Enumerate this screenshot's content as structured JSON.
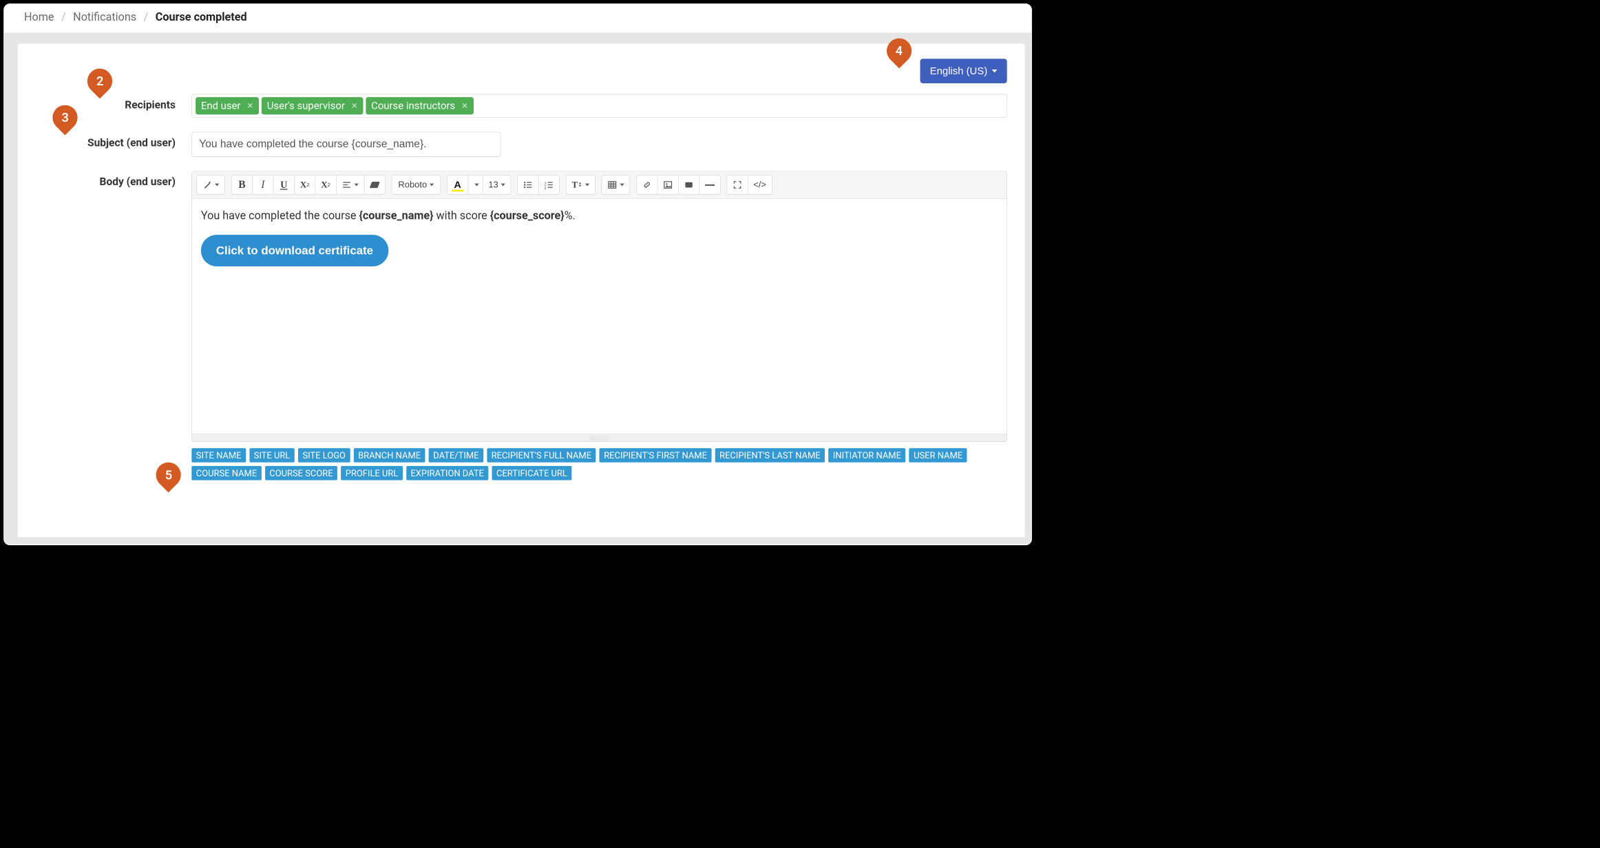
{
  "breadcrumb": {
    "home": "Home",
    "notifications": "Notifications",
    "current": "Course completed"
  },
  "language": {
    "label": "English (US)"
  },
  "form": {
    "recipients_label": "Recipients",
    "subject_label": "Subject (end user)",
    "body_label": "Body (end user)",
    "recipients": [
      {
        "label": "End user"
      },
      {
        "label": "User's supervisor"
      },
      {
        "label": "Course instructors"
      }
    ],
    "subject_value": "You have completed the course {course_name}."
  },
  "toolbar": {
    "font": "Roboto",
    "size": "13"
  },
  "body_content": {
    "prefix": "You have completed the course ",
    "course_name": "{course_name}",
    "mid": " with score ",
    "course_score": "{course_score}",
    "suffix": "%.",
    "download_btn": "Click to download certificate"
  },
  "variables": [
    "SITE NAME",
    "SITE URL",
    "SITE LOGO",
    "BRANCH NAME",
    "DATE/TIME",
    "RECIPIENT'S FULL NAME",
    "RECIPIENT'S FIRST NAME",
    "RECIPIENT'S LAST NAME",
    "INITIATOR NAME",
    "USER NAME",
    "COURSE NAME",
    "COURSE SCORE",
    "PROFILE URL",
    "EXPIRATION DATE",
    "CERTIFICATE URL"
  ],
  "pins": {
    "p2": "2",
    "p3": "3",
    "p4": "4",
    "p5": "5"
  }
}
